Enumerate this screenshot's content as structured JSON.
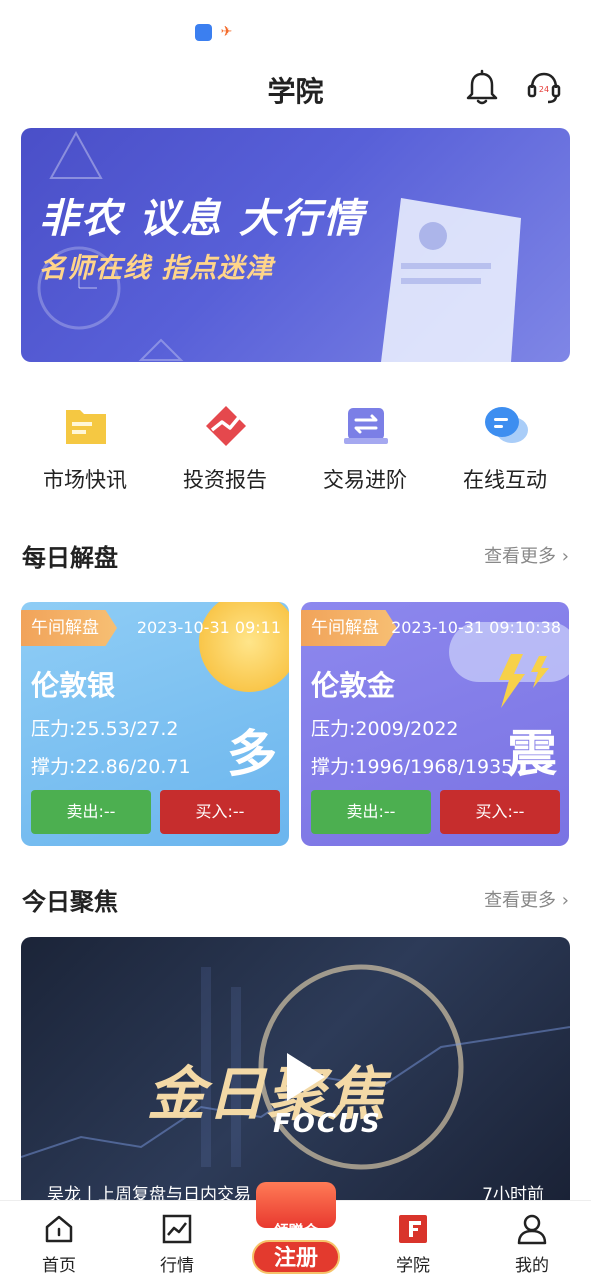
{
  "header": {
    "title": "学院"
  },
  "banner": {
    "title": "非农 议息 大行情",
    "subtitle": "名师在线 指点迷津"
  },
  "quick_menu": [
    {
      "label": "市场快讯",
      "icon": "document-icon",
      "color": "#f5c842"
    },
    {
      "label": "投资报告",
      "icon": "chart-report-icon",
      "color": "#e5484d"
    },
    {
      "label": "交易进阶",
      "icon": "exchange-icon",
      "color": "#7b7fe6"
    },
    {
      "label": "在线互动",
      "icon": "chat-bubble-icon",
      "color": "#3d8ef0"
    }
  ],
  "daily": {
    "title": "每日解盘",
    "more": "查看更多",
    "cards": [
      {
        "tag": "午间解盘",
        "time": "2023-10-31 09:11",
        "name": "伦敦银",
        "pressure": "压力:25.53/27.2",
        "support": "撑力:22.86/20.71",
        "signal": "多",
        "sell": "卖出:--",
        "buy": "买入:--"
      },
      {
        "tag": "午间解盘",
        "time": "2023-10-31 09:10:38",
        "name": "伦敦金",
        "pressure": "压力:2009/2022",
        "support": "撑力:1996/1968/1935",
        "signal": "震",
        "sell": "卖出:--",
        "buy": "买入:--"
      }
    ]
  },
  "focus": {
    "title": "今日聚焦",
    "more": "查看更多",
    "video": {
      "title": "金日聚焦",
      "subtitle": "FOCUS",
      "caption": "吴龙丨上周复盘与日内交易",
      "ago": "7小时前"
    }
  },
  "tabbar": {
    "tabs": [
      {
        "label": "首页",
        "icon": "home-icon"
      },
      {
        "label": "行情",
        "icon": "market-chart-icon"
      },
      {
        "label": "学院",
        "icon": "academy-icon"
      },
      {
        "label": "我的",
        "icon": "user-icon"
      }
    ],
    "promo": {
      "small": "领赠金",
      "big": "注册"
    }
  },
  "colors": {
    "sell": "#4caf50",
    "buy": "#c62d2d",
    "academy_active": "#d9342b"
  }
}
